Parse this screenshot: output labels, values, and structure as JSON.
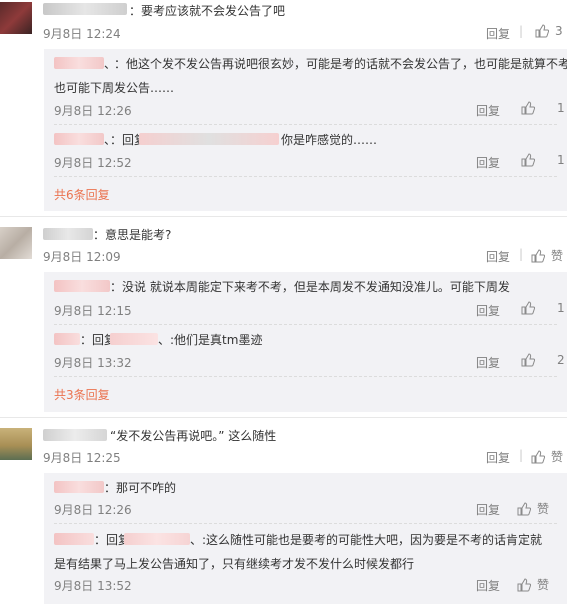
{
  "labels": {
    "reply": "回复",
    "like": "赞"
  },
  "colors": {
    "name": "#eb7350",
    "meta": "#808080",
    "reply_bg": "#f2f2f5"
  },
  "comments": [
    {
      "text": "：要考应该就不会发公告了吧",
      "time": "9月8日 12:24",
      "likes": "3",
      "replies": [
        {
          "text_line1": "：他这个发不发公告再说吧很玄妙，可能是考的话就不会发公告了，也可能是就算不考",
          "text_line2": "也可能下周发公告……",
          "time": "9月8日 12:26",
          "likes": "1"
        },
        {
          "reply_prefix": "：回复",
          "text": "你是咋感觉的……",
          "time": "9月8日 12:52",
          "likes": "1"
        }
      ],
      "more": "共6条回复"
    },
    {
      "text": "：意思是能考?",
      "time": "9月8日 12:09",
      "likes": "赞",
      "replies": [
        {
          "text": "：没说 就说本周能定下来考不考，但是本周发不发通知没准儿。可能下周发",
          "time": "9月8日 12:15",
          "likes": "1"
        },
        {
          "reply_prefix": "：回复",
          "text": ":他们是真tm墨迹",
          "time": "9月8日 13:32",
          "likes": "2"
        }
      ],
      "more": "共3条回复"
    },
    {
      "text": "“发不发公告再说吧。” 这么随性",
      "time": "9月8日 12:25",
      "likes": "赞",
      "replies": [
        {
          "text": "：那可不咋的",
          "time": "9月8日 12:26",
          "likes": "赞"
        },
        {
          "reply_prefix": "：回复",
          "text_line1": ":这么随性可能也是要考的可能性大吧，因为要是不考的话肯定就",
          "text_line2": "是有结果了马上发公告通知了，只有继续考才发不发什么时候发都行",
          "time": "9月8日 13:52",
          "likes": "赞"
        }
      ]
    }
  ]
}
